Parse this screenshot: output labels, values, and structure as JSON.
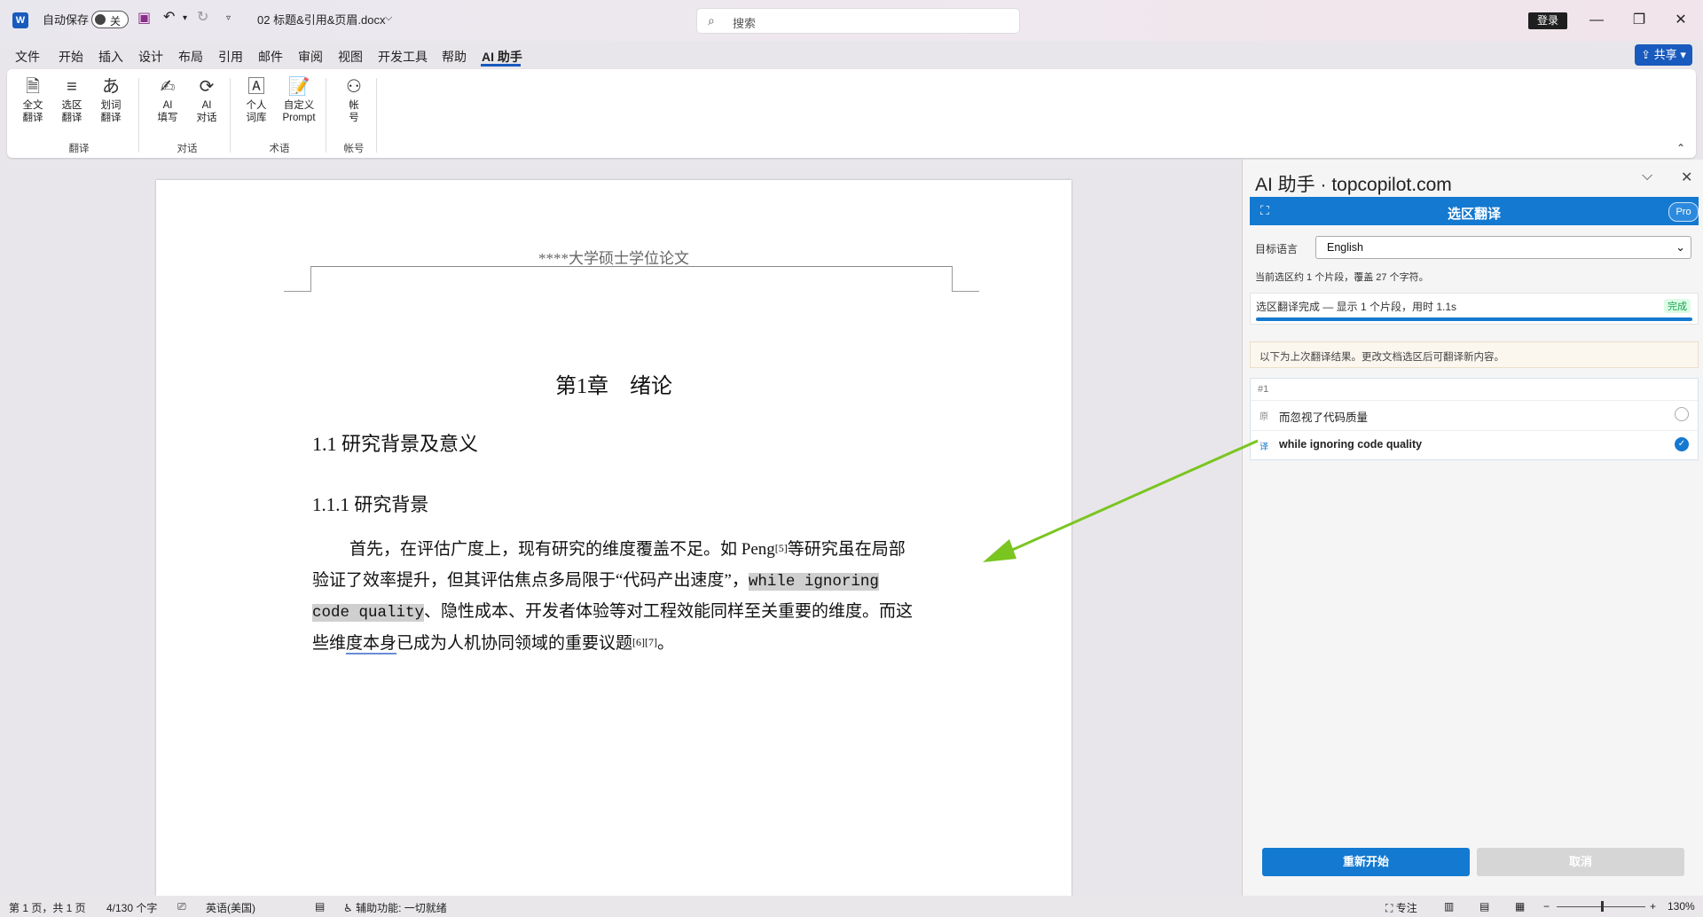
{
  "titlebar": {
    "autosave_label": "自动保存",
    "autosave_state": "关",
    "filename": "02 标题&引用&页眉.docx",
    "search_placeholder": "搜索",
    "login_label": "登录"
  },
  "menu": [
    "文件",
    "开始",
    "插入",
    "设计",
    "布局",
    "引用",
    "邮件",
    "审阅",
    "视图",
    "开发工具",
    "帮助",
    "AI 助手"
  ],
  "share_label": "共享",
  "ribbon": {
    "buttons": [
      {
        "l1": "全文",
        "l2": "翻译"
      },
      {
        "l1": "选区",
        "l2": "翻译"
      },
      {
        "l1": "划词",
        "l2": "翻译"
      },
      {
        "l1": "AI",
        "l2": "填写"
      },
      {
        "l1": "AI",
        "l2": "对话"
      },
      {
        "l1": "个人",
        "l2": "词库"
      },
      {
        "l1": "自定义",
        "l2": "Prompt"
      },
      {
        "l1": "帐",
        "l2": "号"
      }
    ],
    "groups": [
      "翻译",
      "对话",
      "术语",
      "帐号"
    ]
  },
  "document": {
    "header": "****大学硕士学位论文",
    "chapter": "第1章　绪论",
    "h2": "1.1 研究背景及意义",
    "h3": "1.1.1 研究背景",
    "p1a": "首先，在评估广度上，现有研究的维度覆盖不足。如 Peng",
    "sup1": "[5]",
    "p1b": "等研究虽在局部",
    "p2a": "验证了效率提升，但其评估焦点多局限于“代码产出速度”，",
    "hl1": "while  ignoring",
    "hl2": "code quality",
    "p3b": "、隐性成本、开发者体验等对工程效能同样至关重要的维度。而这",
    "p4a": "些维",
    "p4w": "度本身",
    "p4b": "已成为人机协同领域的重要议题",
    "sup2": "[6][7]",
    "p4c": "。"
  },
  "panel": {
    "title": "AI 助手 · topcopilot.com",
    "header": "选区翻译",
    "pro": "Pro",
    "target_label": "目标语言",
    "target_value": "English",
    "selection_info": "当前选区约 1 个片段，覆盖 27 个字符。",
    "progress_text": "选区翻译完成 — 显示 1 个片段，用时 1.1s",
    "progress_status": "完成",
    "progress_fraction": 1.0,
    "notice": "以下为上次翻译结果。更改文档选区后可翻译新内容。",
    "result": {
      "index": "#1",
      "src_tag": "原",
      "src_text": "而忽视了代码质量",
      "tgt_tag": "译",
      "tgt_text": "while ignoring code quality"
    },
    "restart_label": "重新开始",
    "cancel_label": "取消"
  },
  "status": {
    "page": "第 1 页，共 1 页",
    "words": "4/130 个字",
    "language": "英语(美国)",
    "accessibility": "辅助功能: 一切就绪",
    "focus": "专注",
    "zoom": "130%"
  },
  "colors": {
    "accent": "#185abd",
    "panel_accent": "#1479d0",
    "arrow": "#7ac520"
  }
}
